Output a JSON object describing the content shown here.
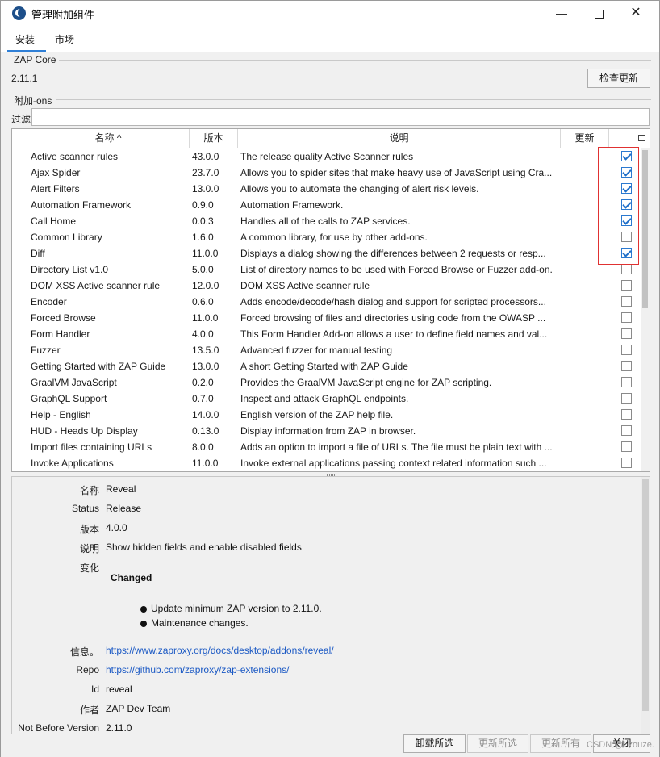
{
  "window": {
    "title": "管理附加组件",
    "min_glyph": "—",
    "close_glyph": "✕"
  },
  "tabs": [
    {
      "label": "安装"
    },
    {
      "label": "市场"
    }
  ],
  "zap_core": {
    "group_label": "ZAP Core",
    "version": "2.11.1",
    "check_updates_label": "检查更新"
  },
  "addons": {
    "group_label": "附加-ons",
    "filter_label": "过滤:",
    "filter_value": "",
    "columns": {
      "name": "名称 ^",
      "version": "版本",
      "description": "说明",
      "update": "更新"
    },
    "rows": [
      {
        "name": "Active scanner rules",
        "version": "43.0.0",
        "description": "The release quality Active Scanner rules",
        "checked": true
      },
      {
        "name": "Ajax Spider",
        "version": "23.7.0",
        "description": "Allows you to spider sites that make heavy use of JavaScript using Cra...",
        "checked": true
      },
      {
        "name": "Alert Filters",
        "version": "13.0.0",
        "description": "Allows you to automate the changing of alert risk levels.",
        "checked": true
      },
      {
        "name": "Automation Framework",
        "version": "0.9.0",
        "description": "Automation Framework.",
        "checked": true
      },
      {
        "name": "Call Home",
        "version": "0.0.3",
        "description": "Handles all of the calls to ZAP services.",
        "checked": true
      },
      {
        "name": "Common Library",
        "version": "1.6.0",
        "description": "A common library, for use by other add-ons.",
        "checked": false
      },
      {
        "name": "Diff",
        "version": "11.0.0",
        "description": "Displays a dialog showing the differences between 2 requests or resp...",
        "checked": true
      },
      {
        "name": "Directory List v1.0",
        "version": "5.0.0",
        "description": "List of directory names to be used with Forced Browse or Fuzzer add-on.",
        "checked": false
      },
      {
        "name": "DOM XSS Active scanner rule",
        "version": "12.0.0",
        "description": "DOM XSS Active scanner rule",
        "checked": false
      },
      {
        "name": "Encoder",
        "version": "0.6.0",
        "description": "Adds encode/decode/hash dialog and support for scripted processors...",
        "checked": false
      },
      {
        "name": "Forced Browse",
        "version": "11.0.0",
        "description": "Forced browsing of files and directories using code from the OWASP ...",
        "checked": false
      },
      {
        "name": "Form Handler",
        "version": "4.0.0",
        "description": "This Form Handler Add-on allows a user to define field names and val...",
        "checked": false
      },
      {
        "name": "Fuzzer",
        "version": "13.5.0",
        "description": "Advanced fuzzer for manual testing",
        "checked": false
      },
      {
        "name": "Getting Started with ZAP Guide",
        "version": "13.0.0",
        "description": "A short Getting Started with ZAP Guide",
        "checked": false
      },
      {
        "name": "GraalVM JavaScript",
        "version": "0.2.0",
        "description": "Provides the GraalVM JavaScript engine for ZAP scripting.",
        "checked": false
      },
      {
        "name": "GraphQL Support",
        "version": "0.7.0",
        "description": "Inspect and attack GraphQL endpoints.",
        "checked": false
      },
      {
        "name": "Help - English",
        "version": "14.0.0",
        "description": "English version of the ZAP help file.",
        "checked": false
      },
      {
        "name": "HUD - Heads Up Display",
        "version": "0.13.0",
        "description": "Display information from ZAP in browser.",
        "checked": false
      },
      {
        "name": "Import files containing URLs",
        "version": "8.0.0",
        "description": "Adds an option to import a file of URLs. The file must be plain text with ...",
        "checked": false
      },
      {
        "name": "Invoke Applications",
        "version": "11.0.0",
        "description": "Invoke external applications passing context related information such ...",
        "checked": false
      }
    ]
  },
  "details": {
    "name_label": "名称",
    "name_value": "Reveal",
    "status_label": "Status",
    "status_value": "Release",
    "version_label": "版本",
    "version_value": "4.0.0",
    "desc_label": "说明",
    "desc_value": "Show hidden fields and enable disabled fields",
    "changes_label": "变化",
    "changes_heading": "Changed",
    "changes": [
      "Update minimum ZAP version to 2.11.0.",
      "Maintenance changes."
    ],
    "info_label": "信息。",
    "info_url": "https://www.zaproxy.org/docs/desktop/addons/reveal/",
    "repo_label": "Repo",
    "repo_url": "https://github.com/zaproxy/zap-extensions/",
    "id_label": "Id",
    "id_value": "reveal",
    "author_label": "作者",
    "author_value": "ZAP Dev Team",
    "not_before_label": "Not Before Version",
    "not_before_value": "2.11.0"
  },
  "footer": {
    "uninstall_label": "卸载所选",
    "update_selected_label": "更新所选",
    "update_all_label": "更新所有",
    "close_label": "关闭"
  },
  "watermark": "CSDN @Lzouze."
}
